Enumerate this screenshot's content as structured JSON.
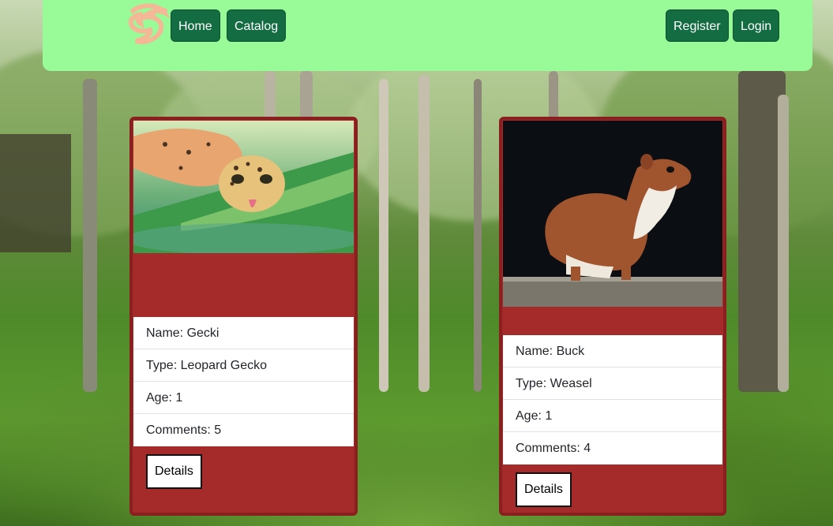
{
  "navbar": {
    "home_label": "Home",
    "catalog_label": "Catalog",
    "register_label": "Register",
    "login_label": "Login",
    "logo_icon": "dragon-logo-icon"
  },
  "colors": {
    "navbar_bg": "#98fb98",
    "nav_button_bg": "#146c43",
    "card_bg": "#a52a2a"
  },
  "pets": [
    {
      "name": "Name: Gecki",
      "type": "Type: Leopard Gecko",
      "age": "Age: 1",
      "comments": "Comments: 5",
      "details_label": "Details",
      "image": "leopard-gecko-photo"
    },
    {
      "name": "Name: Buck",
      "type": "Type: Weasel",
      "age": "Age: 1",
      "comments": "Comments: 4",
      "details_label": "Details",
      "image": "weasel-photo"
    }
  ]
}
